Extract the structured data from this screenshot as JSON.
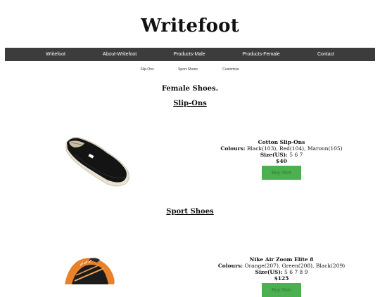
{
  "site": {
    "title": "Writefoot"
  },
  "nav": {
    "items": [
      "Writefoot",
      "About-Writefoot",
      "Products-Male",
      "Products-Female",
      "Contact"
    ]
  },
  "subnav": {
    "items": [
      "Slip-Ons",
      "Sport-Shoes",
      "Customize"
    ]
  },
  "page": {
    "heading": "Female Shoes."
  },
  "sections": [
    {
      "title": "Slip-Ons",
      "product": {
        "name": "Cotton Slip-Ons",
        "colours_label": "Colours:",
        "colours": "Black(103), Red(104), Maroon(105)",
        "size_label": "Size(US):",
        "sizes": "5 6 7",
        "price": "$40",
        "button_label": "Buy Now",
        "image_icon": "black-slip-on-shoe-icon"
      }
    },
    {
      "title": "Sport Shoes",
      "product": {
        "name": "Nike Air Zoom Elite 8",
        "colours_label": "Colours:",
        "colours": "Orange(207), Green(208), Black(209)",
        "size_label": "Size(US):",
        "sizes": "5 6 7 8 9",
        "price": "$125",
        "button_label": "Buy Now",
        "image_icon": "orange-running-shoe-icon"
      }
    }
  ],
  "colors": {
    "nav_bg": "#3c3c3c",
    "button_bg": "#4caf50",
    "page_bg": "#ffffff"
  }
}
